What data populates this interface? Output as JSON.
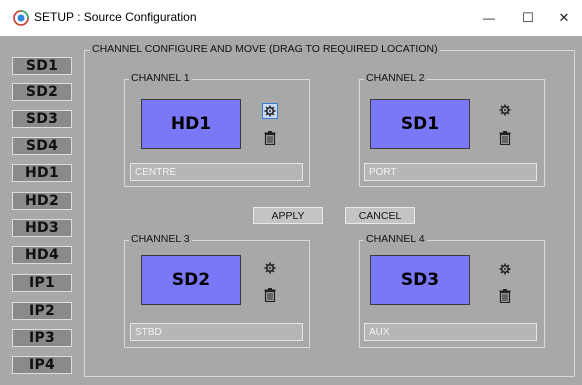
{
  "window": {
    "title": "SETUP : Source Configuration",
    "minimize_glyph": "—",
    "maximize_glyph": "☐",
    "close_glyph": "✕",
    "app_icon": "setup-app-icon"
  },
  "sources": [
    "SD1",
    "SD2",
    "SD3",
    "SD4",
    "HD1",
    "HD2",
    "HD3",
    "HD4",
    "IP1",
    "IP2",
    "IP3",
    "IP4"
  ],
  "main_group": {
    "legend": "CHANNEL CONFIGURE AND MOVE (DRAG TO REQUIRED LOCATION)"
  },
  "channels": [
    {
      "legend": "CHANNEL 1",
      "source": "HD1",
      "location": "CENTRE",
      "settings_icon": "gear-icon",
      "delete_icon": "trash-icon",
      "settings_focused": true
    },
    {
      "legend": "CHANNEL 2",
      "source": "SD1",
      "location": "PORT",
      "settings_icon": "gear-icon",
      "delete_icon": "trash-icon",
      "settings_focused": false
    },
    {
      "legend": "CHANNEL 3",
      "source": "SD2",
      "location": "STBD",
      "settings_icon": "gear-icon",
      "delete_icon": "trash-icon",
      "settings_focused": false
    },
    {
      "legend": "CHANNEL 4",
      "source": "SD3",
      "location": "AUX",
      "settings_icon": "gear-icon",
      "delete_icon": "trash-icon",
      "settings_focused": false
    }
  ],
  "actions": {
    "apply": "APPLY",
    "cancel": "CANCEL"
  },
  "colors": {
    "background": "#a8a8a8",
    "channel_display": "#7b78f8",
    "source_button": "#8a8a8a"
  }
}
